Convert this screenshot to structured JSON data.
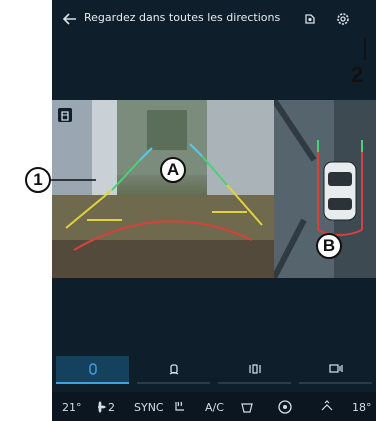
{
  "header": {
    "title": "Regardez dans toutes les directions",
    "back_icon": "back-arrow-icon",
    "secondary_icon": "camera-mode-icon",
    "settings_icon": "gear-icon"
  },
  "callouts": {
    "c1": "1",
    "c2": "2",
    "cA": "A",
    "cB": "B"
  },
  "bottom_tabs": [
    {
      "icon": "rear-camera-icon",
      "active": true
    },
    {
      "icon": "front-camera-icon",
      "active": false
    },
    {
      "icon": "side-camera-icon",
      "active": false
    },
    {
      "icon": "sensor-icon",
      "active": false
    }
  ],
  "climate": {
    "temp_left": "21°",
    "fan": "2",
    "sync": "SYNC",
    "ac": "A/C",
    "temp_right": "18°"
  },
  "colors": {
    "screen_bg": "#0f1e2b",
    "accent": "#3ea3e0",
    "guide_red": "#d8403a",
    "guide_yellow": "#e2d23a",
    "guide_green": "#4bd07a",
    "guide_cyan": "#59c7e6"
  }
}
